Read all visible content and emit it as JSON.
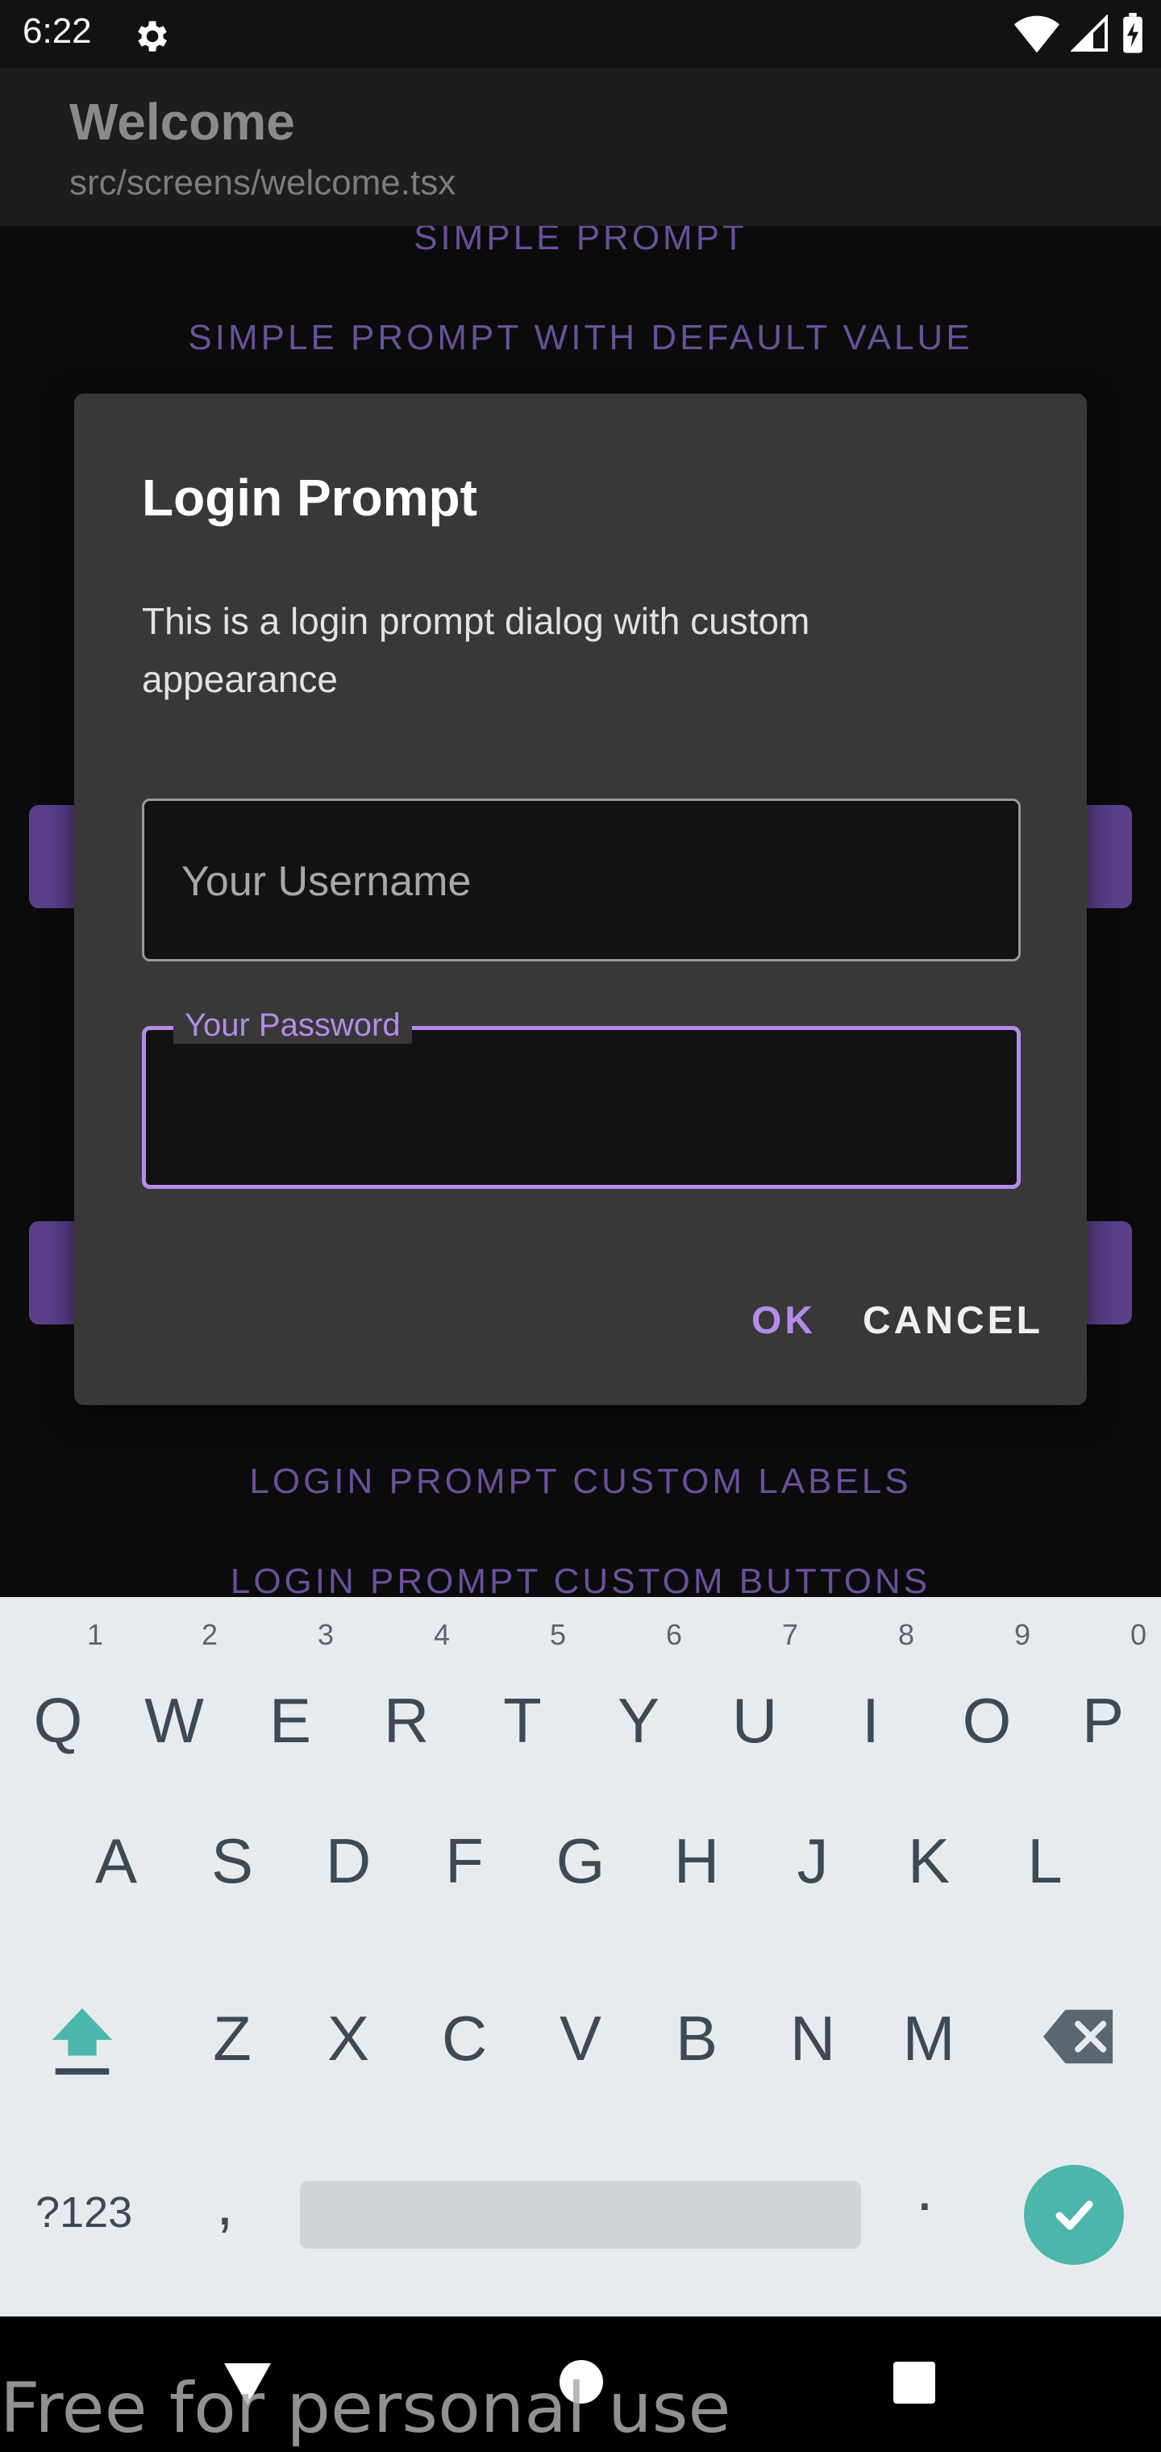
{
  "status_bar": {
    "time": "6:22"
  },
  "app_header": {
    "title": "Welcome",
    "subtitle": "src/screens/welcome.tsx"
  },
  "background": {
    "links": [
      "SIMPLE PROMPT",
      "SIMPLE PROMPT WITH DEFAULT VALUE",
      "LOGIN PROMPT CUSTOM LABELS",
      "LOGIN PROMPT CUSTOM BUTTONS"
    ]
  },
  "dialog": {
    "title": "Login Prompt",
    "message": "This is a login prompt dialog with custom appearance",
    "username": {
      "placeholder": "Your Username",
      "value": ""
    },
    "password": {
      "label": "Your Password",
      "value": ""
    },
    "ok_label": "OK",
    "cancel_label": "CANCEL",
    "accent_color": "#b58be8"
  },
  "keyboard": {
    "row1": [
      "Q",
      "W",
      "E",
      "R",
      "T",
      "Y",
      "U",
      "I",
      "O",
      "P"
    ],
    "row1_hints": [
      "",
      "1",
      "2",
      "3",
      "4",
      "5",
      "6",
      "7",
      "8",
      "9",
      "0"
    ],
    "row2": [
      "A",
      "S",
      "D",
      "F",
      "G",
      "H",
      "J",
      "K",
      "L"
    ],
    "row3": [
      "Z",
      "X",
      "C",
      "V",
      "B",
      "N",
      "M"
    ],
    "symbols_label": "?123",
    "comma": ",",
    "period": "."
  },
  "watermark": "Free for personal use"
}
